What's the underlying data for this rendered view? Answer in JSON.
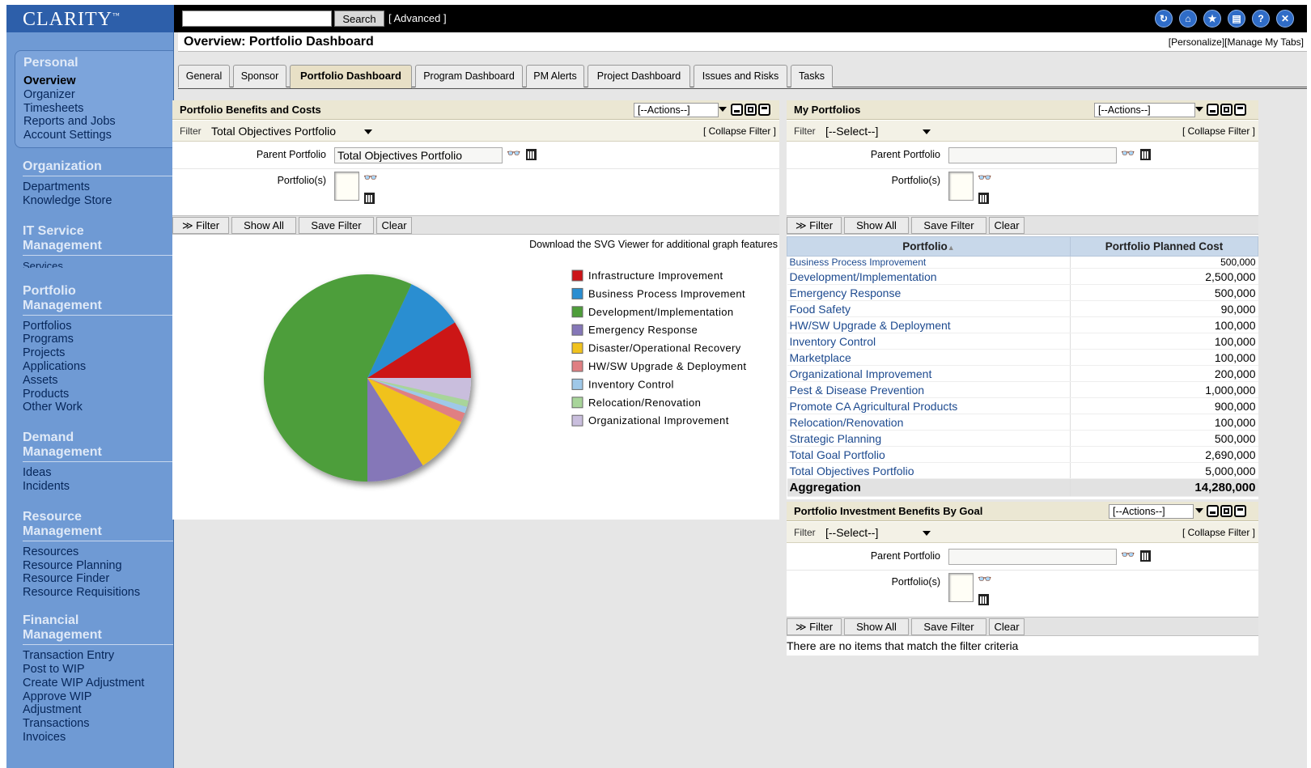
{
  "app": {
    "logo": "CLARITY",
    "logo_tm": "™",
    "search_button": "Search",
    "advanced_link": "[ Advanced ]",
    "top_icons": [
      "refresh-icon",
      "home-icon",
      "bookmark-icon",
      "printer-icon",
      "help-icon",
      "close-icon"
    ]
  },
  "sidebar": {
    "personal": {
      "heading": "Personal",
      "items": [
        "Overview",
        "Organizer",
        "Timesheets",
        "Reports and Jobs",
        "Account Settings"
      ]
    },
    "organization": {
      "heading": "Organization",
      "items": [
        "Departments",
        "Knowledge Store"
      ]
    },
    "it_service": {
      "heading_1": "IT Service",
      "heading_2": "Management",
      "items": [
        "Services"
      ]
    },
    "portfolio": {
      "heading_1": "Portfolio",
      "heading_2": "Management",
      "items": [
        "Portfolios",
        "Programs",
        "Projects",
        "Applications",
        "Assets",
        "Products",
        "Other Work"
      ]
    },
    "demand": {
      "heading_1": "Demand",
      "heading_2": "Management",
      "items": [
        "Ideas",
        "Incidents"
      ]
    },
    "resource": {
      "heading_1": "Resource",
      "heading_2": "Management",
      "items": [
        "Resources",
        "Resource Planning",
        "Resource Finder",
        "Resource Requisitions"
      ]
    },
    "financial": {
      "heading_1": "Financial",
      "heading_2": "Management",
      "items": [
        "Transaction Entry",
        "Post to WIP",
        "Create WIP Adjustment",
        "Approve WIP",
        "Adjustment",
        "Transactions",
        "Invoices"
      ]
    }
  },
  "header": {
    "title": "Overview: Portfolio Dashboard",
    "links": "[Personalize][Manage My Tabs]"
  },
  "tabs": [
    "General",
    "Sponsor",
    "Portfolio Dashboard",
    "Program Dashboard",
    "PM Alerts",
    "Project Dashboard",
    "Issues and Risks",
    "Tasks"
  ],
  "benefits": {
    "title": "Portfolio Benefits and Costs",
    "actions": "[--Actions--]",
    "filter_label": "Filter",
    "filter_value": "Total Objectives Portfolio",
    "collapse": "[ Collapse Filter ]",
    "parent_label": "Parent Portfolio",
    "parent_value": "Total Objectives Portfolio",
    "portfolios_label": "Portfolio(s)",
    "buttons": [
      "≫ Filter",
      "Show All",
      "Save Filter",
      "Clear"
    ],
    "svg_note": "Download the SVG Viewer for additional graph features"
  },
  "chart_data": {
    "type": "pie",
    "labels": [
      "Infrastructure Improvement",
      "Business Process Improvement",
      "Development/Implementation",
      "Emergency Response",
      "Disaster/Operational Recovery",
      "HW/SW Upgrade & Deployment",
      "Inventory Control",
      "Relocation/Renovation",
      "Organizational Improvement"
    ],
    "values": [
      9,
      9,
      57,
      9,
      9,
      1.5,
      1,
      1,
      3.5
    ],
    "colors": [
      "#cc1418",
      "#2b8ed1",
      "#4e9e3a",
      "#8577b8",
      "#f0c21e",
      "#e07f82",
      "#9fc8e8",
      "#a8d59a",
      "#c9bedd"
    ],
    "legend": "right"
  },
  "my_portfolios": {
    "title": "My Portfolios",
    "actions": "[--Actions--]",
    "filter_label": "Filter",
    "filter_value": "[--Select--]",
    "collapse": "[ Collapse Filter ]",
    "parent_label": "Parent Portfolio",
    "portfolios_label": "Portfolio(s)",
    "buttons": [
      "≫ Filter",
      "Show All",
      "Save Filter",
      "Clear"
    ],
    "columns": [
      "Portfolio",
      "Portfolio Planned Cost"
    ],
    "sort_marker": "▲",
    "rows": [
      [
        "Business Process Improvement",
        "500,000"
      ],
      [
        "Development/Implementation",
        "2,500,000"
      ],
      [
        "Emergency Response",
        "500,000"
      ],
      [
        "Food Safety",
        "90,000"
      ],
      [
        "HW/SW Upgrade & Deployment",
        "100,000"
      ],
      [
        "Inventory Control",
        "100,000"
      ],
      [
        "Marketplace",
        "100,000"
      ],
      [
        "Organizational Improvement",
        "200,000"
      ],
      [
        "Pest & Disease Prevention",
        "1,000,000"
      ],
      [
        "Promote CA Agricultural Products",
        "900,000"
      ],
      [
        "Relocation/Renovation",
        "100,000"
      ],
      [
        "Strategic Planning",
        "500,000"
      ],
      [
        "Total Goal Portfolio",
        "2,690,000"
      ],
      [
        "Total Objectives Portfolio",
        "5,000,000"
      ]
    ],
    "aggregation_label": "Aggregation",
    "aggregation_value": "14,280,000"
  },
  "benefits_by_goal": {
    "title": "Portfolio Investment Benefits By Goal",
    "actions": "[--Actions--]",
    "filter_label": "Filter",
    "filter_value": "[--Select--]",
    "collapse": "[ Collapse Filter ]",
    "parent_label": "Parent Portfolio",
    "portfolios_label": "Portfolio(s)",
    "buttons": [
      "≫ Filter",
      "Show All",
      "Save Filter",
      "Clear"
    ],
    "empty_message": "There are no items that match the filter criteria"
  }
}
